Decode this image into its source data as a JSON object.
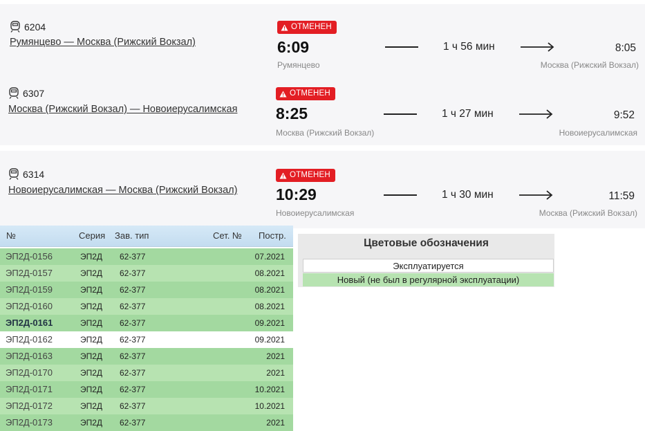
{
  "trips": [
    {
      "number": "6204",
      "route": "Румянцево — Москва (Рижский Вокзал)",
      "status": "ОТМЕНЕН",
      "departure": "6:09",
      "duration": "1 ч 56 мин",
      "arrival": "8:05",
      "from_station": "Румянцево",
      "to_station": "Москва (Рижский Вокзал)"
    },
    {
      "number": "6307",
      "route": "Москва (Рижский Вокзал) — Новоиерусалимская",
      "status": "ОТМЕНЕН",
      "departure": "8:25",
      "duration": "1 ч 27 мин",
      "arrival": "9:52",
      "from_station": "Москва (Рижский Вокзал)",
      "to_station": "Новоиерусалимская"
    },
    {
      "number": "6314",
      "route": "Новоиерусалимская — Москва (Рижский Вокзал)",
      "status": "ОТМЕНЕН",
      "departure": "10:29",
      "duration": "1 ч 30 мин",
      "arrival": "11:59",
      "from_station": "Новоиерусалимская",
      "to_station": "Москва (Рижский Вокзал)"
    }
  ],
  "table": {
    "headers": {
      "num": "№",
      "series": "Серия",
      "zav_type": "Зав. тип",
      "set_num": "Сет. №",
      "built": "Постр."
    },
    "rows": [
      {
        "id": "ЭП2Д-0156",
        "series": "ЭП2Д",
        "zav_type": "62-377",
        "built": "07.2021"
      },
      {
        "id": "ЭП2Д-0157",
        "series": "ЭП2Д",
        "zav_type": "62-377",
        "built": "08.2021"
      },
      {
        "id": "ЭП2Д-0159",
        "series": "ЭП2Д",
        "zav_type": "62-377",
        "built": "08.2021"
      },
      {
        "id": "ЭП2Д-0160",
        "series": "ЭП2Д",
        "zav_type": "62-377",
        "built": "08.2021"
      },
      {
        "id": "ЭП2Д-0161",
        "series": "ЭП2Д",
        "zav_type": "62-377",
        "built": "09.2021"
      },
      {
        "id": "ЭП2Д-0162",
        "series": "ЭП2Д",
        "zav_type": "62-377",
        "built": "09.2021"
      },
      {
        "id": "ЭП2Д-0163",
        "series": "ЭП2Д",
        "zav_type": "62-377",
        "built": "2021"
      },
      {
        "id": "ЭП2Д-0170",
        "series": "ЭП2Д",
        "zav_type": "62-377",
        "built": "2021"
      },
      {
        "id": "ЭП2Д-0171",
        "series": "ЭП2Д",
        "zav_type": "62-377",
        "built": "10.2021"
      },
      {
        "id": "ЭП2Д-0172",
        "series": "ЭП2Д",
        "zav_type": "62-377",
        "built": "10.2021"
      },
      {
        "id": "ЭП2Д-0173",
        "series": "ЭП2Д",
        "zav_type": "62-377",
        "built": "2021"
      }
    ]
  },
  "legend": {
    "title": "Цветовые обозначения",
    "in_service": "Эксплуатируется",
    "new": "Новый (не был в регулярной эксплуатации)"
  },
  "colors": {
    "cancel_badge": "#e31e24",
    "row_green_dark": "#a3d9a0",
    "row_green_light": "#b7e3b1",
    "header_blue": "#d6e9f7"
  },
  "icons": {
    "train": "train-icon",
    "warning": "warning-icon",
    "arrow": "arrow-right-icon"
  }
}
